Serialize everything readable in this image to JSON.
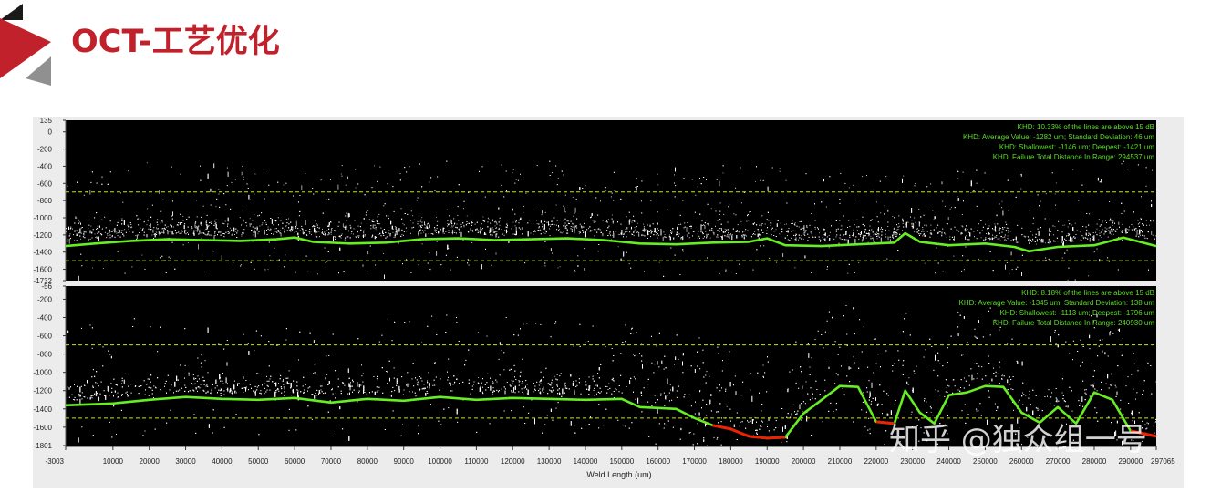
{
  "slide": {
    "title": "OCT-工艺优化",
    "watermark": "知乎 @独众组一号"
  },
  "colors": {
    "accent_red": "#c0212b",
    "logo_gray": "#909090",
    "trace_green": "#66ee22",
    "fail_red": "#ee2200",
    "limit_line": "#c8e020",
    "info_text": "#5cdc28",
    "plot_bg": "#000000"
  },
  "chart_data": [
    {
      "type": "scatter",
      "title": "",
      "xlabel": "Weld Length (um)",
      "ylabel": "",
      "xlim": [
        -3003,
        297065
      ],
      "ylim": [
        -1732,
        135
      ],
      "y_ticks": [
        135,
        0,
        -200,
        -400,
        -600,
        -800,
        -1000,
        -1200,
        -1400,
        -1600,
        -1732
      ],
      "x_ticks": [
        -3003,
        10000,
        20000,
        30000,
        40000,
        50000,
        60000,
        70000,
        80000,
        90000,
        100000,
        110000,
        120000,
        130000,
        140000,
        150000,
        160000,
        170000,
        180000,
        190000,
        200000,
        210000,
        220000,
        230000,
        240000,
        250000,
        260000,
        270000,
        280000,
        290000,
        297065
      ],
      "upper_limit": -700,
      "lower_limit": -1500,
      "info_lines": [
        "KHD: 10.33% of the lines are above 15 dB",
        "KHD: Average Value: -1282 um; Standard Deviation: 46 um",
        "KHD: Shallowest: -1146 um; Deepest: -1421 um",
        "KHD: Failure Total Distance In Range: 294537 um"
      ],
      "series": [
        {
          "x": [
            -3003,
            5000,
            15000,
            25000,
            35000,
            45000,
            55000,
            60000,
            65000,
            75000,
            85000,
            95000,
            105000,
            115000,
            125000,
            135000,
            145000,
            155000,
            165000,
            175000,
            185000,
            190000,
            195000,
            205000,
            215000,
            225000,
            228000,
            232000,
            240000,
            250000,
            258000,
            262000,
            270000,
            280000,
            288000,
            297065
          ],
          "y": [
            -1330,
            -1300,
            -1270,
            -1250,
            -1260,
            -1270,
            -1250,
            -1230,
            -1280,
            -1300,
            -1290,
            -1250,
            -1240,
            -1260,
            -1250,
            -1240,
            -1260,
            -1300,
            -1310,
            -1290,
            -1280,
            -1240,
            -1320,
            -1330,
            -1310,
            -1290,
            -1180,
            -1280,
            -1320,
            -1300,
            -1340,
            -1390,
            -1340,
            -1320,
            -1230,
            -1330
          ]
        }
      ]
    },
    {
      "type": "scatter",
      "title": "",
      "xlabel": "Weld Length (um)",
      "ylabel": "",
      "xlim": [
        -3003,
        297065
      ],
      "ylim": [
        -1801,
        -56
      ],
      "y_ticks": [
        -56,
        -200,
        -400,
        -600,
        -800,
        -1000,
        -1200,
        -1400,
        -1600,
        -1801
      ],
      "x_ticks": [
        -3003,
        10000,
        20000,
        30000,
        40000,
        50000,
        60000,
        70000,
        80000,
        90000,
        100000,
        110000,
        120000,
        130000,
        140000,
        150000,
        160000,
        170000,
        180000,
        190000,
        200000,
        210000,
        220000,
        230000,
        240000,
        250000,
        260000,
        270000,
        280000,
        290000,
        297065
      ],
      "upper_limit": -700,
      "lower_limit": -1500,
      "info_lines": [
        "KHD: 8.18% of the lines are above 15 dB",
        "KHD: Average Value: -1345 um; Standard Deviation: 138 um",
        "KHD: Shallowest: -1113 um; Deepest: -1796 um",
        "KHD: Failure Total Distance In Range: 240930 um"
      ],
      "series": [
        {
          "x": [
            -3003,
            10000,
            20000,
            30000,
            40000,
            50000,
            60000,
            70000,
            80000,
            90000,
            100000,
            110000,
            120000,
            130000,
            140000,
            150000,
            155000,
            160000,
            165000,
            170000,
            175000,
            180000,
            185000,
            190000,
            195000,
            200000,
            205000,
            210000,
            215000,
            220000,
            225000,
            228000,
            232000,
            236000,
            240000,
            245000,
            250000,
            255000,
            260000,
            265000,
            270000,
            275000,
            280000,
            285000,
            290000,
            297065
          ],
          "y": [
            -1360,
            -1340,
            -1300,
            -1270,
            -1290,
            -1300,
            -1280,
            -1330,
            -1290,
            -1310,
            -1270,
            -1300,
            -1280,
            -1290,
            -1300,
            -1290,
            -1380,
            -1390,
            -1400,
            -1500,
            -1580,
            -1620,
            -1700,
            -1720,
            -1710,
            -1450,
            -1300,
            -1150,
            -1160,
            -1540,
            -1560,
            -1200,
            -1440,
            -1560,
            -1250,
            -1220,
            -1150,
            -1160,
            -1440,
            -1550,
            -1380,
            -1560,
            -1220,
            -1300,
            -1640,
            -1700
          ]
        }
      ]
    }
  ]
}
